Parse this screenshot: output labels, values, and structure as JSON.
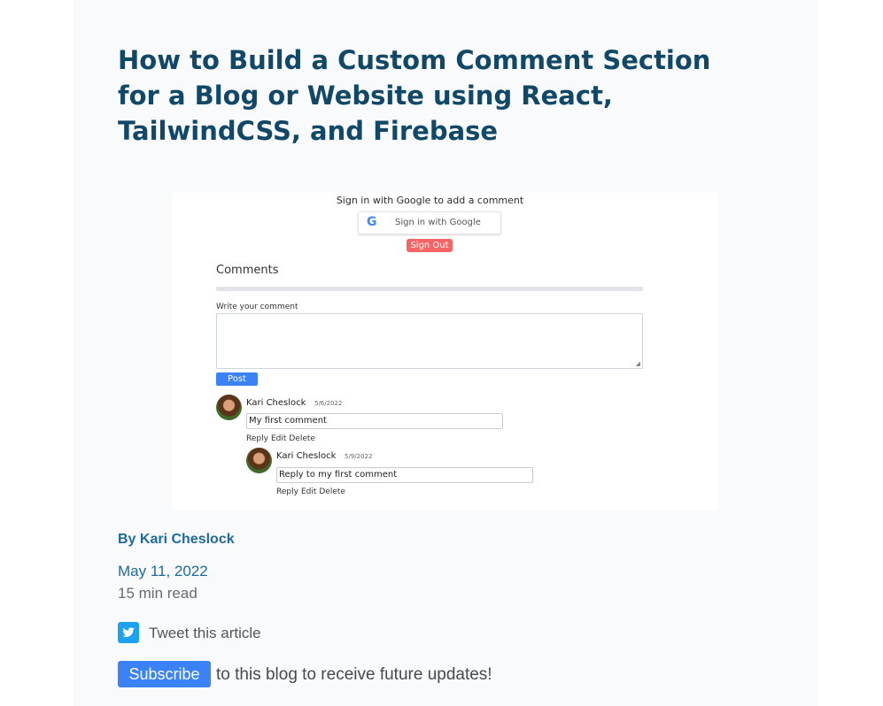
{
  "article": {
    "title": "How to Build a Custom Comment Section for a Blog or Website using React, TailwindCSS, and Firebase",
    "author": "By Kari Cheslock",
    "date": "May 11, 2022",
    "read_time": "15 min read",
    "tweet_label": "Tweet this article",
    "subscribe_label": "Subscribe",
    "subscribe_text": "to this blog to receive future updates!"
  },
  "screenshot": {
    "signin_prompt": "Sign in with Google to add a comment",
    "google_letter": "G",
    "google_button": "Sign in with Google",
    "sign_out": "Sign Out",
    "comments_heading": "Comments",
    "write_label": "Write your comment",
    "post_button": "Post",
    "comments": [
      {
        "author": "Kari Cheslock",
        "date": "5/6/2022",
        "text": "My first comment",
        "actions": [
          "Reply",
          "Edit",
          "Delete"
        ]
      },
      {
        "author": "Kari Cheslock",
        "date": "5/9/2022",
        "text": "Reply to my first comment",
        "actions": [
          "Reply",
          "Edit",
          "Delete"
        ]
      }
    ]
  },
  "colors": {
    "title": "#114868",
    "link": "#1d6a9b",
    "twitter": "#1da1f2",
    "subscribe": "#3b82f6",
    "sign_out": "#f56565"
  }
}
